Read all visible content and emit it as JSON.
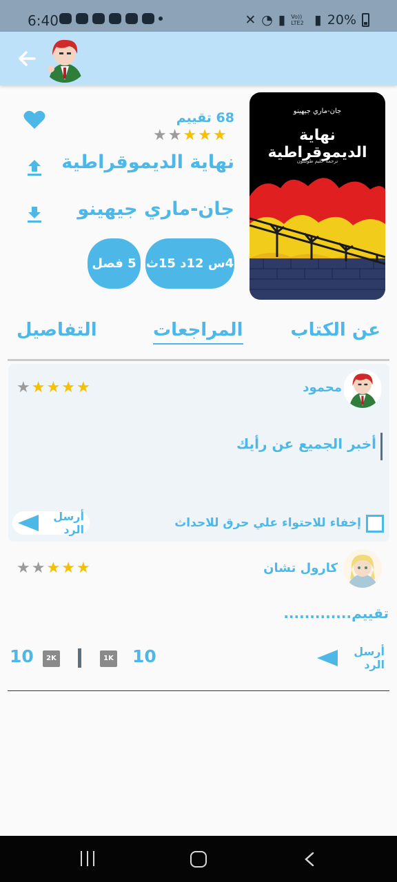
{
  "status_bar": {
    "time": "6:40",
    "battery": "20%",
    "network_label": "Vo)) LTE2"
  },
  "app_bar": {
    "back_icon": "arrow-left-icon"
  },
  "book": {
    "cover": {
      "author": "جان-ماري جيهينو",
      "title": "نهاية الديموقراطية",
      "translator": "ترجمة حليم طوسون"
    },
    "rating_count": "68 تقييم",
    "rating": 3,
    "rating_max": 5,
    "title": "نهاية الديموقراطية",
    "author": "جان-ماري جيهينو",
    "duration": "4س 12د 15ث",
    "chapters": "5 فصل"
  },
  "tabs": [
    {
      "label": "عن الكتاب",
      "active": false
    },
    {
      "label": "المراجعات",
      "active": true
    },
    {
      "label": "التفاصيل",
      "active": false
    }
  ],
  "compose_review": {
    "user_name": "محمود",
    "rating": 4,
    "prompt": "أخبر الجميع عن رأيك",
    "spoiler_label": "إخفاء للاحتواء علي حرق للاحداث",
    "reply_label": "أرسل الرد"
  },
  "reviews": [
    {
      "user_name": "كارول تشان",
      "rating": 3,
      "text": "تقييم.............",
      "reply_label": "أرسل الرد",
      "likes": "10",
      "likes_badge": "1K",
      "dislikes": "10",
      "dislikes_badge": "2K"
    }
  ],
  "colors": {
    "accent": "#4db8e8",
    "app_bar": "#bde1f8",
    "star_on": "#f5c000",
    "star_off": "#9b9b9b"
  }
}
